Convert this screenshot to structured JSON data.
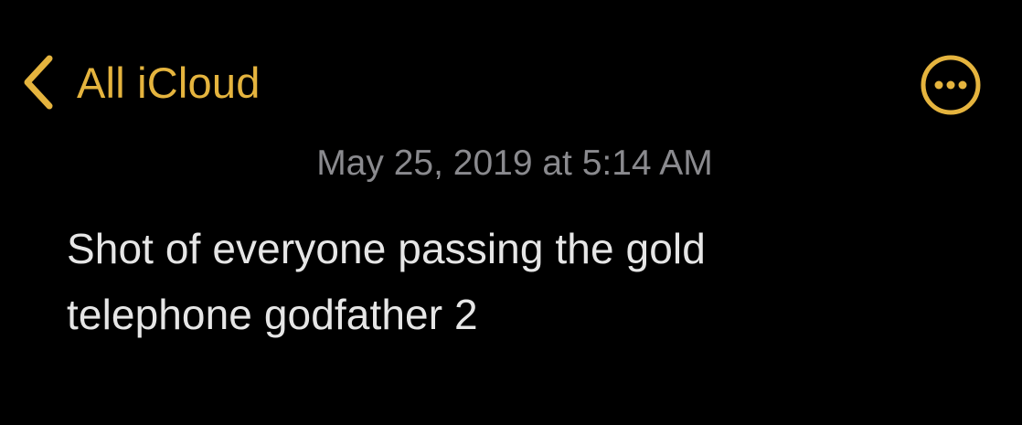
{
  "nav": {
    "back_label": "All iCloud",
    "back_icon": "chevron-left-icon",
    "more_icon": "ellipsis-circle-icon",
    "accent_color": "#E5B43E"
  },
  "note": {
    "timestamp": "May 25, 2019 at 5:14 AM",
    "body": "Shot of everyone passing the gold telephone godfather 2"
  },
  "colors": {
    "background": "#000000",
    "timestamp_text": "#8A8A8E",
    "body_text": "#E6E6E6"
  }
}
